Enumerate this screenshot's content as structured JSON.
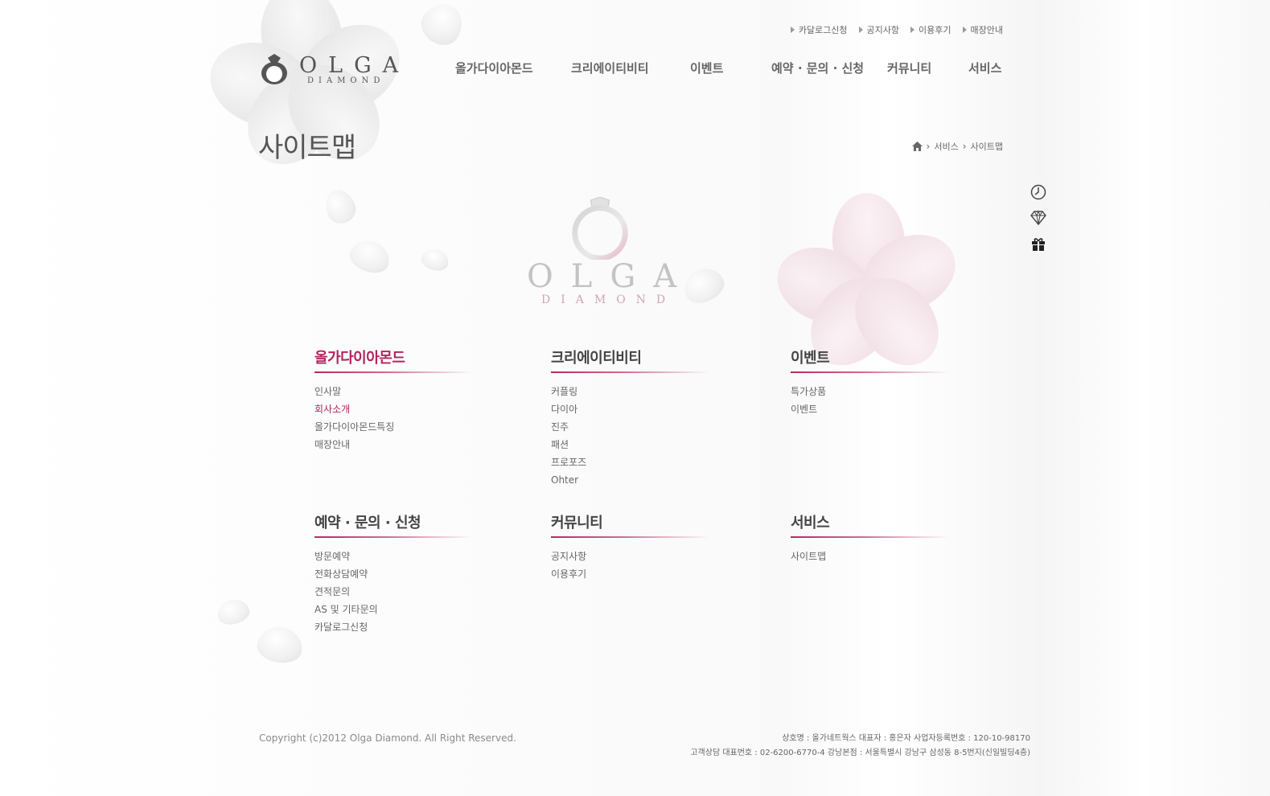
{
  "util_nav": [
    "카달로그신청",
    "공지사항",
    "이용후기",
    "매장안내"
  ],
  "logo": {
    "name": "OLGA",
    "sub": "DIAMOND"
  },
  "gnb": [
    "올가다이아몬드",
    "크리에이티비티",
    "이벤트",
    "예약 · 문의 · 신청",
    "커뮤니티",
    "서비스"
  ],
  "page_title": "사이트맵",
  "breadcrumb": {
    "level1": "서비스",
    "level2": "사이트맵"
  },
  "quick_icons": [
    "clock-icon",
    "diamond-icon",
    "gift-icon"
  ],
  "center_logo": {
    "name": "OLGA",
    "sub": "DIAMOND"
  },
  "sections": [
    {
      "title": "올가다이아몬드",
      "items": [
        "인사말",
        "회사소개",
        "올가다이아몬드특징",
        "매장안내"
      ]
    },
    {
      "title": "크리에이티비티",
      "items": [
        "커플링",
        "다이아",
        "진주",
        "패션",
        "프로포즈",
        "Ohter"
      ]
    },
    {
      "title": "이벤트",
      "items": [
        "특가상품",
        "이벤트"
      ]
    },
    {
      "title": "예약 · 문의 · 신청",
      "items": [
        "방문예약",
        "전화상담예약",
        "견적문의",
        "AS 및 기타문의",
        "카달로그신청"
      ]
    },
    {
      "title": "커뮤니티",
      "items": [
        "공지사항",
        "이용후기"
      ]
    },
    {
      "title": "서비스",
      "items": [
        "사이트맵"
      ]
    }
  ],
  "footer": {
    "copyright": "Copyright (c)2012 Olga Diamond. All Right Reserved.",
    "line1": "상호명 : 올가네트웍스    대표자 : 홍은자    사업자등록번호 : 120-10-98170",
    "line2": "고객상담 대표번호 : 02-6200-6770-4    강남본점 : 서울특별시 강남구 삼성동 8-5번지(신일빌딩4층)"
  },
  "colors": {
    "accent": "#b0245f",
    "text": "#555555"
  }
}
